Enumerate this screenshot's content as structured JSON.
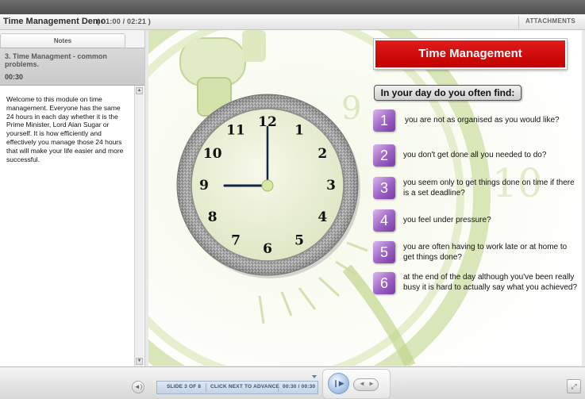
{
  "window": {
    "title": "Time Management Demo",
    "timer": "( 01:00 / 02:21 )",
    "attachments_label": "ATTACHMENTS"
  },
  "sidebar": {
    "tab_label": "Notes",
    "slide_title": "3. Time Managment - common problems.",
    "slide_duration": "00:30",
    "notes_text": "Welcome to this module on time management. Everyone has the same 24 hours in each day whether it is the Prime Minister, Lord Alan Sugar or yourself. It is how efficiently and effectively you manage those 24 hours that will make your life easier and more successful."
  },
  "slide": {
    "banner_title": "Time Management",
    "question": "In your day do you often find:",
    "clock_numbers": [
      "12",
      "1",
      "2",
      "3",
      "4",
      "5",
      "6",
      "7",
      "8",
      "9",
      "10",
      "11"
    ],
    "clock_time": {
      "hour": 9,
      "minute": 0
    },
    "bg_numbers": [
      "9",
      "10"
    ],
    "items": [
      {
        "number": "1",
        "text": "you are not as organised as you would like?"
      },
      {
        "number": "2",
        "text": "you don't get done all you needed to do?"
      },
      {
        "number": "3",
        "text": "you seem only to get things done on time if there is a set deadline?"
      },
      {
        "number": "4",
        "text": "you feel under pressure?"
      },
      {
        "number": "5",
        "text": "you are often having to work late or at home to get things done?"
      },
      {
        "number": "6",
        "text": "at the end of the day although you've been really busy it is hard to actually say what you achieved?"
      }
    ]
  },
  "player": {
    "slide_counter": "SLIDE 3 OF 8",
    "advance_hint": "CLICK NEXT TO ADVANCE",
    "slide_time": "00:30 / 00:30"
  },
  "icons": {
    "volume": "speaker-icon",
    "play": "play-pause-icon",
    "prev": "previous-icon",
    "next": "next-icon",
    "fullscreen": "fullscreen-icon"
  },
  "colors": {
    "banner_red": "#d10c0c",
    "badge_purple": "#9b62c2",
    "bg_green": "#cfe0a9"
  }
}
